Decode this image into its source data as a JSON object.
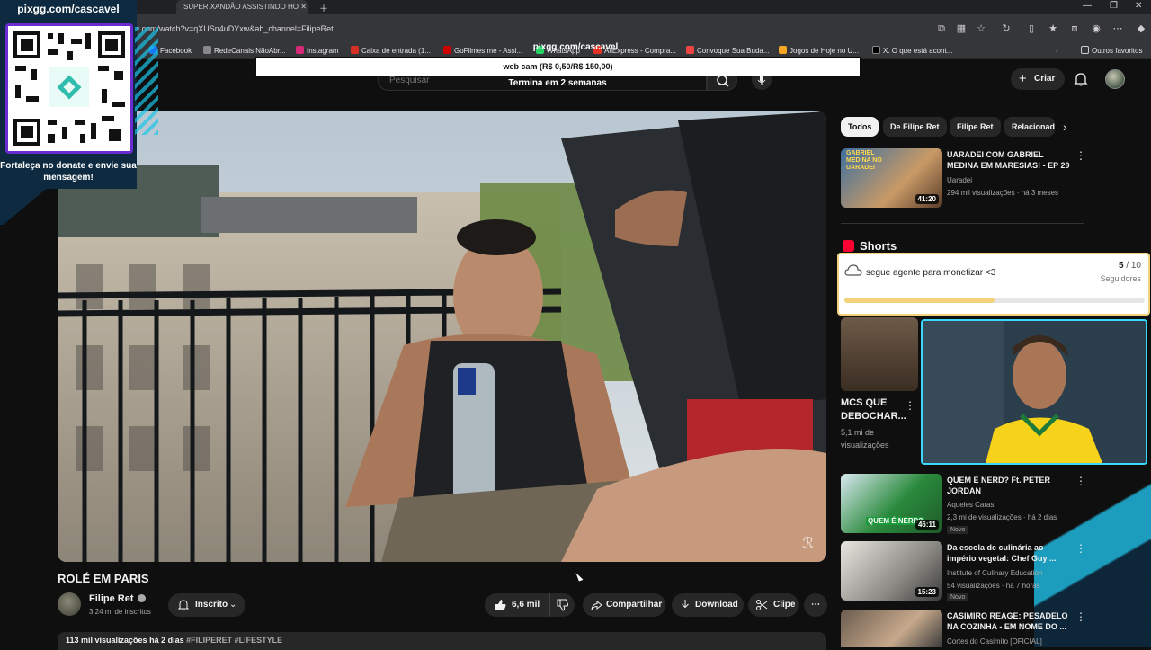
{
  "browser": {
    "active_tab_title": "SUPER XANDÃO ASSISTINDO HO",
    "url": "e.com/watch?v=qXUSn4uDYxw&ab_channel=FilipeRet",
    "bookmarks": [
      "Facebook",
      "RedeCanais NãoAbr...",
      "Instagram",
      "Caixa de entrada (1...",
      "GoFilmes.me - Assi...",
      "WhatsApp",
      "AliExpress - Compra...",
      "Convoque Sua Buda...",
      "Jogos de Hoje no U...",
      "X. O que está acont..."
    ],
    "other_favorites": "Outros favoritos"
  },
  "overlay": {
    "pix_title": "pixgg.com/cascavel",
    "pix_message": "Fortaleça no donate e envie sua mensagem!",
    "webcam_url": "pixgg.com/cascavel",
    "webcam_price": "web cam (R$ 0,50/R$ 150,00)",
    "webcam_ends": "Termina em 2 semanas",
    "goal_text": "segue agente para monetizar <3",
    "goal_current": "5",
    "goal_total": "/ 10",
    "goal_label": "Seguidores",
    "goal_progress": 0.5
  },
  "header": {
    "search_placeholder": "Pesquisar",
    "create_label": "Criar"
  },
  "video": {
    "title": "ROLÉ EM PARIS",
    "channel_name": "Filipe Ret",
    "subscribers": "3,24 mi de inscritos",
    "subscribe_label": "Inscrito",
    "likes": "6,6 mil",
    "share_label": "Compartilhar",
    "download_label": "Download",
    "clip_label": "Clipe",
    "views": "113 mil visualizações",
    "age": "há 2 dias",
    "tags": "#FILIPERET #LIFESTYLE"
  },
  "chips": [
    "Todos",
    "De Filipe Ret",
    "Filipe Ret",
    "Relacionad"
  ],
  "sidebar": {
    "videos": [
      {
        "title": "UARADEI COM GABRIEL MEDINA EM MARESIAS! - EP 29",
        "channel": "Uaradei",
        "meta": "294 mil visualizações · há 3 meses",
        "duration": "41:20",
        "thumb_text": "GABRIEL MEDINA NO UARADEI"
      },
      {
        "title": "QUEM É NERD? Ft. PETER JORDAN",
        "channel": "Aqueles Caras",
        "meta": "2,3 mi de visualizações · há 2 dias",
        "duration": "46:11",
        "badge": "Novo",
        "thumb_text": "QUEM É NERD?"
      },
      {
        "title": "Da escola de culinária ao império vegetal: Chef Guy ...",
        "channel": "Institute of Culinary Education",
        "meta": "54 visualizações · há 7 horas",
        "duration": "15:23",
        "badge": "Novo"
      },
      {
        "title": "CASIMIRO REAGE: PESADELO NA COZINHA - EM NOME DO ...",
        "channel": "Cortes do Casimito [OFICIAL]",
        "meta": ""
      }
    ],
    "shorts_title": "Shorts",
    "short": {
      "title": "MCS QUE DEBOCHAR...",
      "meta": "5,1 mi de visualizações"
    }
  }
}
